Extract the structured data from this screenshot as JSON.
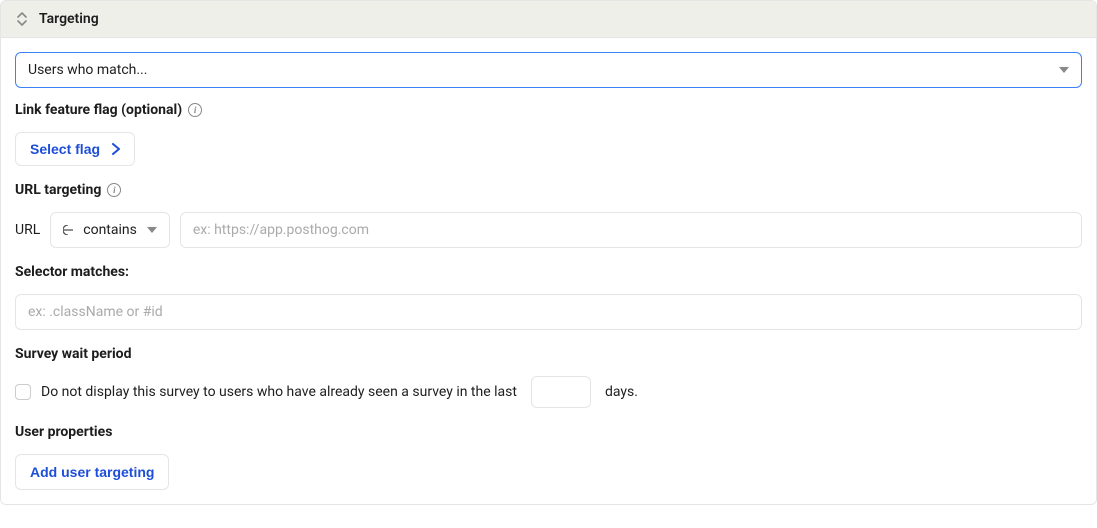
{
  "panel": {
    "title": "Targeting"
  },
  "targeting_select": {
    "label": "Users who match..."
  },
  "feature_flag": {
    "label": "Link feature flag (optional)",
    "button": "Select flag"
  },
  "url_targeting": {
    "label": "URL targeting",
    "url_label": "URL",
    "match_type": "contains",
    "placeholder": "ex: https://app.posthog.com"
  },
  "selector": {
    "label": "Selector matches:",
    "placeholder": "ex: .className or #id"
  },
  "wait_period": {
    "label": "Survey wait period",
    "checkbox_text_before": "Do not display this survey to users who have already seen a survey in the last",
    "checkbox_text_after": "days.",
    "value": ""
  },
  "user_properties": {
    "label": "User properties",
    "button": "Add user targeting"
  }
}
